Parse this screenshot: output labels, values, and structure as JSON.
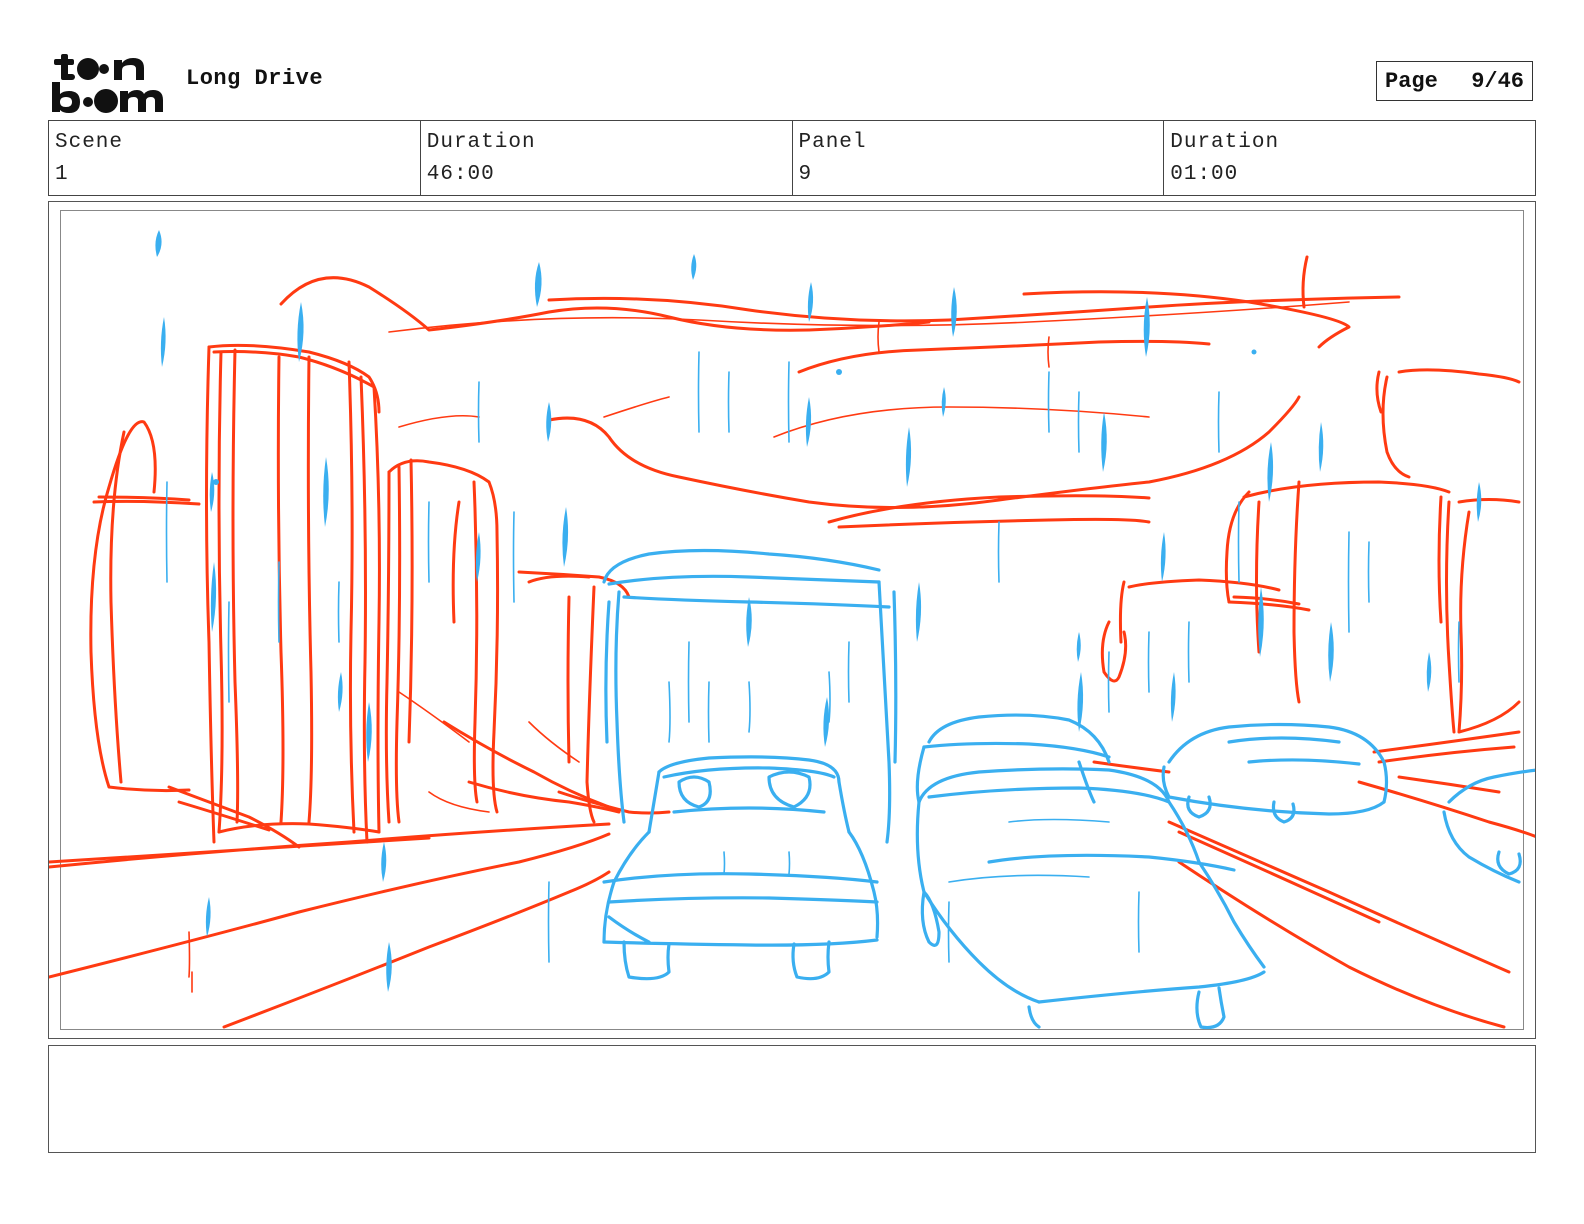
{
  "header": {
    "logo_text": "toon boom",
    "project_title": "Long Drive",
    "page_label": "Page",
    "page_number": "9/46"
  },
  "info": {
    "scene_label": "Scene",
    "scene_value": "1",
    "scene_duration_label": "Duration",
    "scene_duration_value": "46:00",
    "panel_label": "Panel",
    "panel_value": "9",
    "panel_duration_label": "Duration",
    "panel_duration_value": "01:00"
  },
  "panel": {
    "sketch_colors": {
      "background_layer": "#ff3a12",
      "vehicles_rain_layer": "#3aaff0"
    }
  },
  "notes": {
    "text": ""
  }
}
